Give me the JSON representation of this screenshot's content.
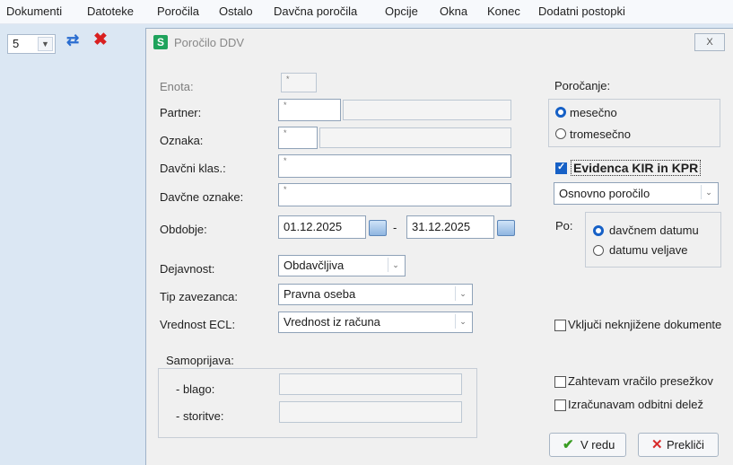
{
  "menu": [
    "Dokumenti",
    "Datoteke",
    "Poročila",
    "Ostalo",
    "Davčna poročila",
    "Opcije",
    "Okna",
    "Konec",
    "Dodatni postopki"
  ],
  "toolbar": {
    "combo_value": "5",
    "refresh_icon": "refresh-icon",
    "delete_icon": "red-x-icon"
  },
  "dialog": {
    "title": "Poročilo DDV",
    "logo_letter": "S",
    "close_label": "X",
    "fields": {
      "enota": {
        "label": "Enota:",
        "value": "*"
      },
      "partner": {
        "label": "Partner:",
        "value": "*"
      },
      "oznaka": {
        "label": "Oznaka:",
        "value": "*"
      },
      "davcni_klas": {
        "label": "Davčni klas.:",
        "value": "*"
      },
      "davcne_oznake": {
        "label": "Davčne oznake:",
        "value": "*"
      },
      "obdobje": {
        "label": "Obdobje:",
        "from": "01.12.2025",
        "separator": "-",
        "to": "31.12.2025"
      },
      "dejavnost": {
        "label": "Dejavnost:",
        "value": "Obdavčljiva"
      },
      "tip_zavezanca": {
        "label": "Tip zavezanca:",
        "value": "Pravna oseba"
      },
      "vrednost_ecl": {
        "label": "Vrednost ECL:",
        "value": "Vrednost iz računa"
      }
    },
    "samoprijava": {
      "label": "Samoprijava:",
      "blago": "- blago:",
      "storitve": "- storitve:"
    },
    "porocanje": {
      "label": "Poročanje:",
      "options": [
        "mesečno",
        "tromesečno"
      ],
      "selected": "mesečno"
    },
    "evidenca": {
      "label": "Evidenca KIR in KPR",
      "checked": true
    },
    "porocilo_select": "Osnovno poročilo",
    "po": {
      "label": "Po:",
      "options": [
        "davčnem datumu",
        "datumu veljave"
      ],
      "selected": "davčnem datumu"
    },
    "checkboxes": [
      "Vključi neknjižene dokumente",
      "Zahtevam vračilo presežkov",
      "Izračunavam odbitni delež"
    ],
    "buttons": {
      "ok": "V redu",
      "cancel": "Prekliči"
    }
  }
}
